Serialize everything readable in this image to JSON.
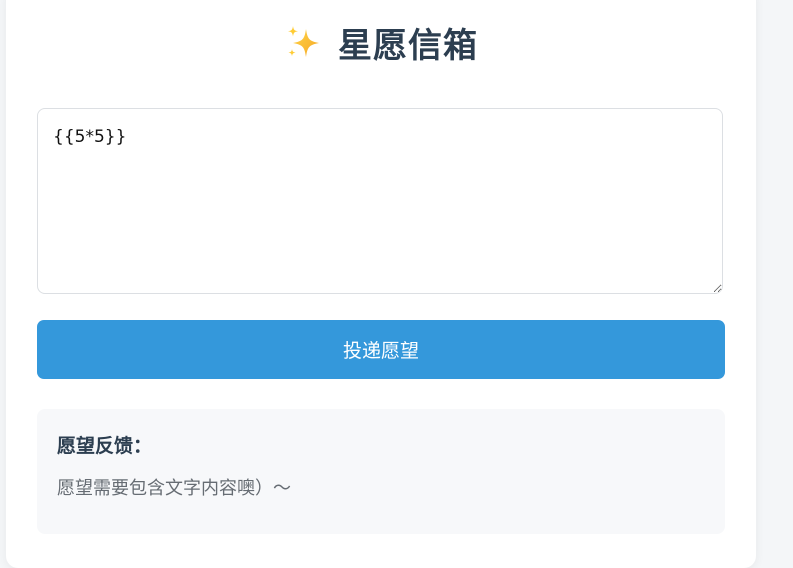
{
  "header": {
    "icon": "sparkles-icon",
    "title": "星愿信箱"
  },
  "wish_input": {
    "value": "{{5*5}}"
  },
  "submit_button": {
    "label": "投递愿望",
    "color": "#3498db"
  },
  "feedback": {
    "title": "愿望反馈：",
    "message": "愿望需要包含文字内容噢）～"
  }
}
